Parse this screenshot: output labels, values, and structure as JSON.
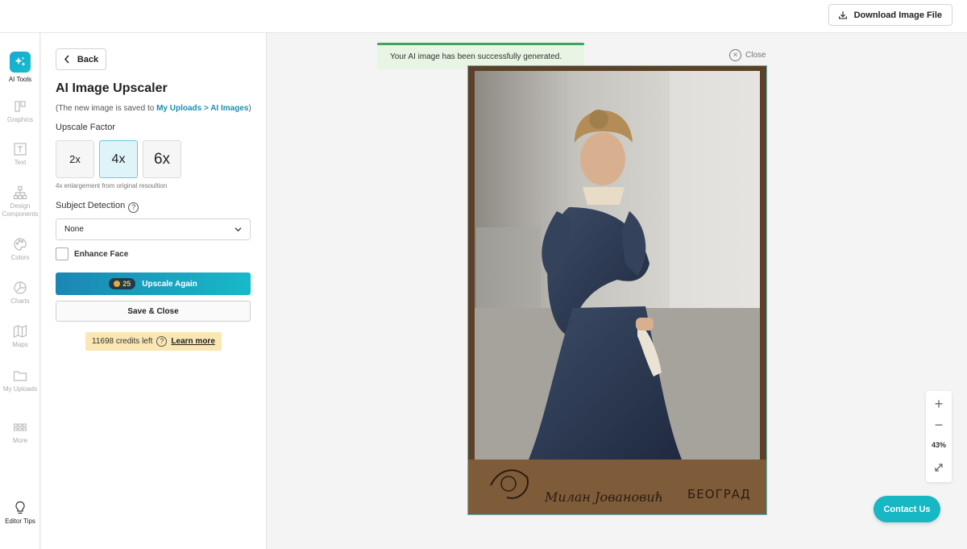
{
  "header": {
    "download_label": "Download Image File"
  },
  "rail": {
    "items": [
      {
        "label": "AI Tools",
        "icon": "sparkles-icon",
        "active": true
      },
      {
        "label": "Graphics",
        "icon": "graphics-icon"
      },
      {
        "label": "Text",
        "icon": "text-icon"
      },
      {
        "label": "Design Components",
        "icon": "sitemap-icon"
      },
      {
        "label": "Colors",
        "icon": "palette-icon"
      },
      {
        "label": "Charts",
        "icon": "pie-chart-icon"
      },
      {
        "label": "Maps",
        "icon": "map-icon"
      },
      {
        "label": "My Uploads",
        "icon": "folder-icon"
      },
      {
        "label": "More",
        "icon": "grid-icon"
      }
    ],
    "tips_label": "Editor Tips"
  },
  "panel": {
    "back_label": "Back",
    "title": "AI Image Upscaler",
    "note_prefix": "(The new image is saved to ",
    "note_link": "My Uploads > AI Images",
    "note_suffix": ")",
    "upscale_factor_label": "Upscale Factor",
    "factors": [
      "2x",
      "4x",
      "6x"
    ],
    "selected_factor": "4x",
    "factor_help": "4x enlargement from original resoultion",
    "subject_detection_label": "Subject Detection",
    "subject_detection_value": "None",
    "enhance_face_label": "Enhance Face",
    "enhance_face_checked": false,
    "upscale_cost": "25",
    "upscale_label": "Upscale Again",
    "save_label": "Save & Close",
    "credits_text": "11698 credits left",
    "learn_more": "Learn more"
  },
  "canvas": {
    "toast": "Your AI image has been successfully generated.",
    "close_label": "Close",
    "zoom_level": "43%",
    "photo_caption_city": "БЕОГРАД"
  },
  "contact_label": "Contact Us",
  "colors": {
    "accent": "#17b7c4",
    "brand_gradient_start": "#1c86b4",
    "toast_bg": "#e8f4e4",
    "credits_bg": "#fbe7b4"
  }
}
